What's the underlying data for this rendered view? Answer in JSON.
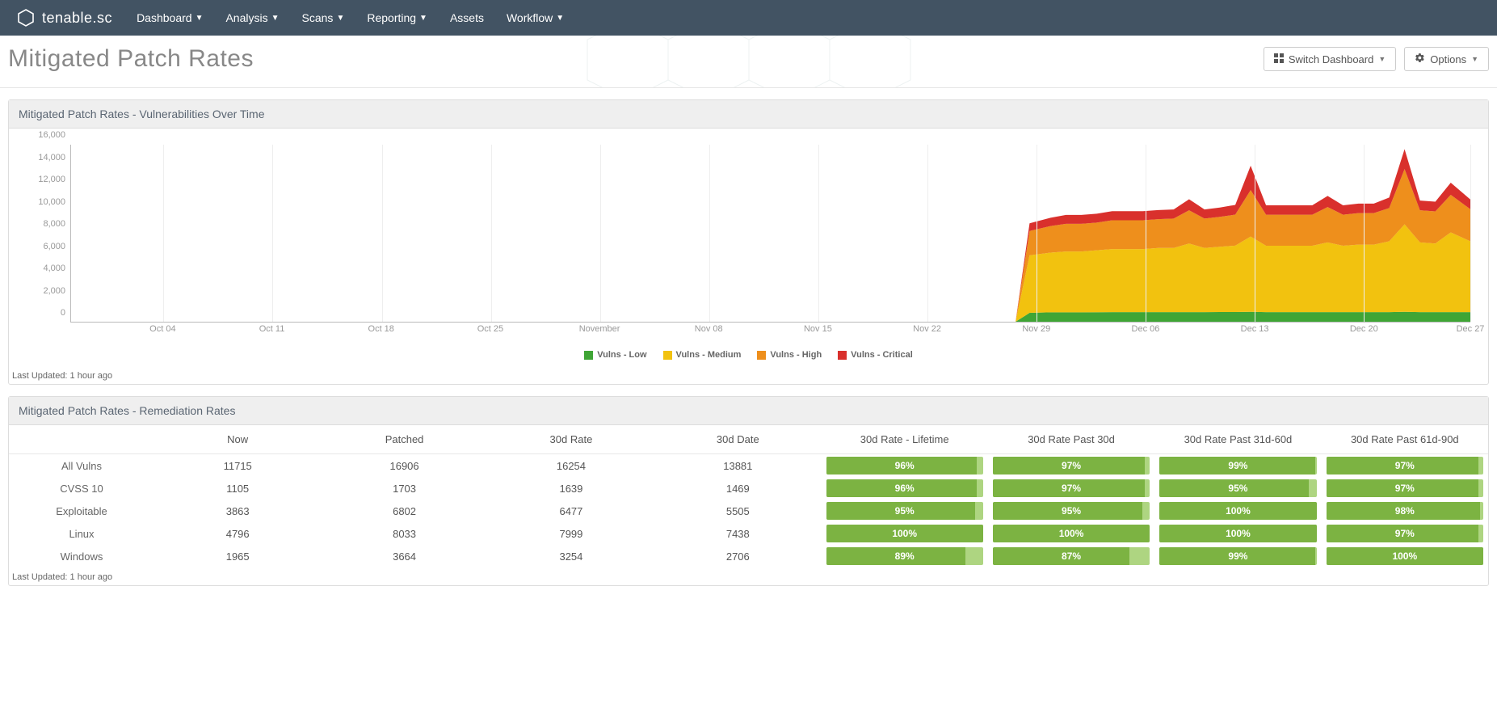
{
  "brand": "tenable.sc",
  "nav": [
    "Dashboard",
    "Analysis",
    "Scans",
    "Reporting",
    "Assets",
    "Workflow"
  ],
  "nav_has_caret": [
    true,
    true,
    true,
    true,
    false,
    true
  ],
  "page_title": "Mitigated Patch Rates",
  "btn_switch": "Switch Dashboard",
  "btn_options": "Options",
  "panel1_title": "Mitigated Patch Rates - Vulnerabilities Over Time",
  "panel2_title": "Mitigated Patch Rates - Remediation Rates",
  "last_updated": "Last Updated: 1 hour ago",
  "chart_data": {
    "type": "area",
    "ylim": [
      0,
      16000
    ],
    "y_ticks": [
      0,
      2000,
      4000,
      6000,
      8000,
      10000,
      12000,
      14000,
      16000
    ],
    "y_tick_labels": [
      "0",
      "2,000",
      "4,000",
      "6,000",
      "8,000",
      "10,000",
      "12,000",
      "14,000",
      "16,000"
    ],
    "x_labels": [
      "Oct 04",
      "Oct 11",
      "Oct 18",
      "Oct 25",
      "November",
      "Nov 08",
      "Nov 15",
      "Nov 22",
      "Nov 29",
      "Dec 06",
      "Dec 13",
      "Dec 20",
      "Dec 27"
    ],
    "x_positions_pct": [
      6.6,
      14.4,
      22.2,
      30.0,
      37.8,
      45.6,
      53.4,
      61.2,
      69.0,
      76.8,
      84.6,
      92.4,
      100.0
    ],
    "legend": [
      {
        "name": "Vulns - Low",
        "color": "#3fa535"
      },
      {
        "name": "Vulns - Medium",
        "color": "#f2c20f"
      },
      {
        "name": "Vulns - High",
        "color": "#ee8f1c"
      },
      {
        "name": "Vulns - Critical",
        "color": "#d9302c"
      }
    ],
    "data_x_pct": [
      67.5,
      68.5,
      70.0,
      71.1,
      72.2,
      73.3,
      74.4,
      75.5,
      76.6,
      77.7,
      78.8,
      79.9,
      81.0,
      82.1,
      83.2,
      84.3,
      85.4,
      86.5,
      87.6,
      88.7,
      89.8,
      90.9,
      92.0,
      93.1,
      94.2,
      95.3,
      96.4,
      97.5,
      98.6,
      100.0
    ],
    "series": [
      {
        "name": "Vulns - Low",
        "color": "#3fa535",
        "values": [
          0,
          800,
          850,
          850,
          850,
          860,
          870,
          870,
          870,
          870,
          870,
          870,
          870,
          880,
          880,
          900,
          870,
          870,
          870,
          870,
          870,
          870,
          870,
          870,
          870,
          900,
          870,
          870,
          870,
          870
        ]
      },
      {
        "name": "Vulns - Medium",
        "color": "#f2c20f",
        "values": [
          0,
          5200,
          5400,
          5500,
          5500,
          5600,
          5700,
          5700,
          5700,
          5800,
          5800,
          6200,
          5800,
          5900,
          6000,
          6800,
          6000,
          6000,
          6000,
          6000,
          6300,
          6000,
          6100,
          6100,
          6400,
          7900,
          6300,
          6200,
          7200,
          6400
        ]
      },
      {
        "name": "Vulns - High",
        "color": "#ee8f1c",
        "values": [
          0,
          2200,
          2400,
          2500,
          2500,
          2500,
          2600,
          2600,
          2600,
          2600,
          2650,
          3000,
          2650,
          2700,
          2800,
          4200,
          2800,
          2800,
          2800,
          2800,
          3200,
          2800,
          2850,
          2850,
          3000,
          5000,
          2900,
          2900,
          3400,
          2900
        ]
      },
      {
        "name": "Vulns - Critical",
        "color": "#d9302c",
        "values": [
          0,
          700,
          750,
          800,
          800,
          800,
          820,
          820,
          820,
          820,
          830,
          1000,
          830,
          840,
          880,
          2200,
          850,
          850,
          850,
          850,
          1000,
          850,
          860,
          860,
          950,
          1800,
          880,
          880,
          1100,
          880
        ]
      }
    ]
  },
  "table": {
    "headers": [
      "",
      "Now",
      "Patched",
      "30d Rate",
      "30d Date",
      "30d Rate - Lifetime",
      "30d Rate Past 30d",
      "30d Rate Past 31d-60d",
      "30d Rate Past 61d-90d"
    ],
    "rows": [
      {
        "label": "All Vulns",
        "now": "11715",
        "patched": "16906",
        "rate30": "16254",
        "date30": "13881",
        "pct": [
          96,
          97,
          99,
          97
        ]
      },
      {
        "label": "CVSS 10",
        "now": "1105",
        "patched": "1703",
        "rate30": "1639",
        "date30": "1469",
        "pct": [
          96,
          97,
          95,
          97
        ]
      },
      {
        "label": "Exploitable",
        "now": "3863",
        "patched": "6802",
        "rate30": "6477",
        "date30": "5505",
        "pct": [
          95,
          95,
          100,
          98
        ]
      },
      {
        "label": "Linux",
        "now": "4796",
        "patched": "8033",
        "rate30": "7999",
        "date30": "7438",
        "pct": [
          100,
          100,
          100,
          97
        ]
      },
      {
        "label": "Windows",
        "now": "1965",
        "patched": "3664",
        "rate30": "3254",
        "date30": "2706",
        "pct": [
          89,
          87,
          99,
          100
        ]
      }
    ]
  }
}
